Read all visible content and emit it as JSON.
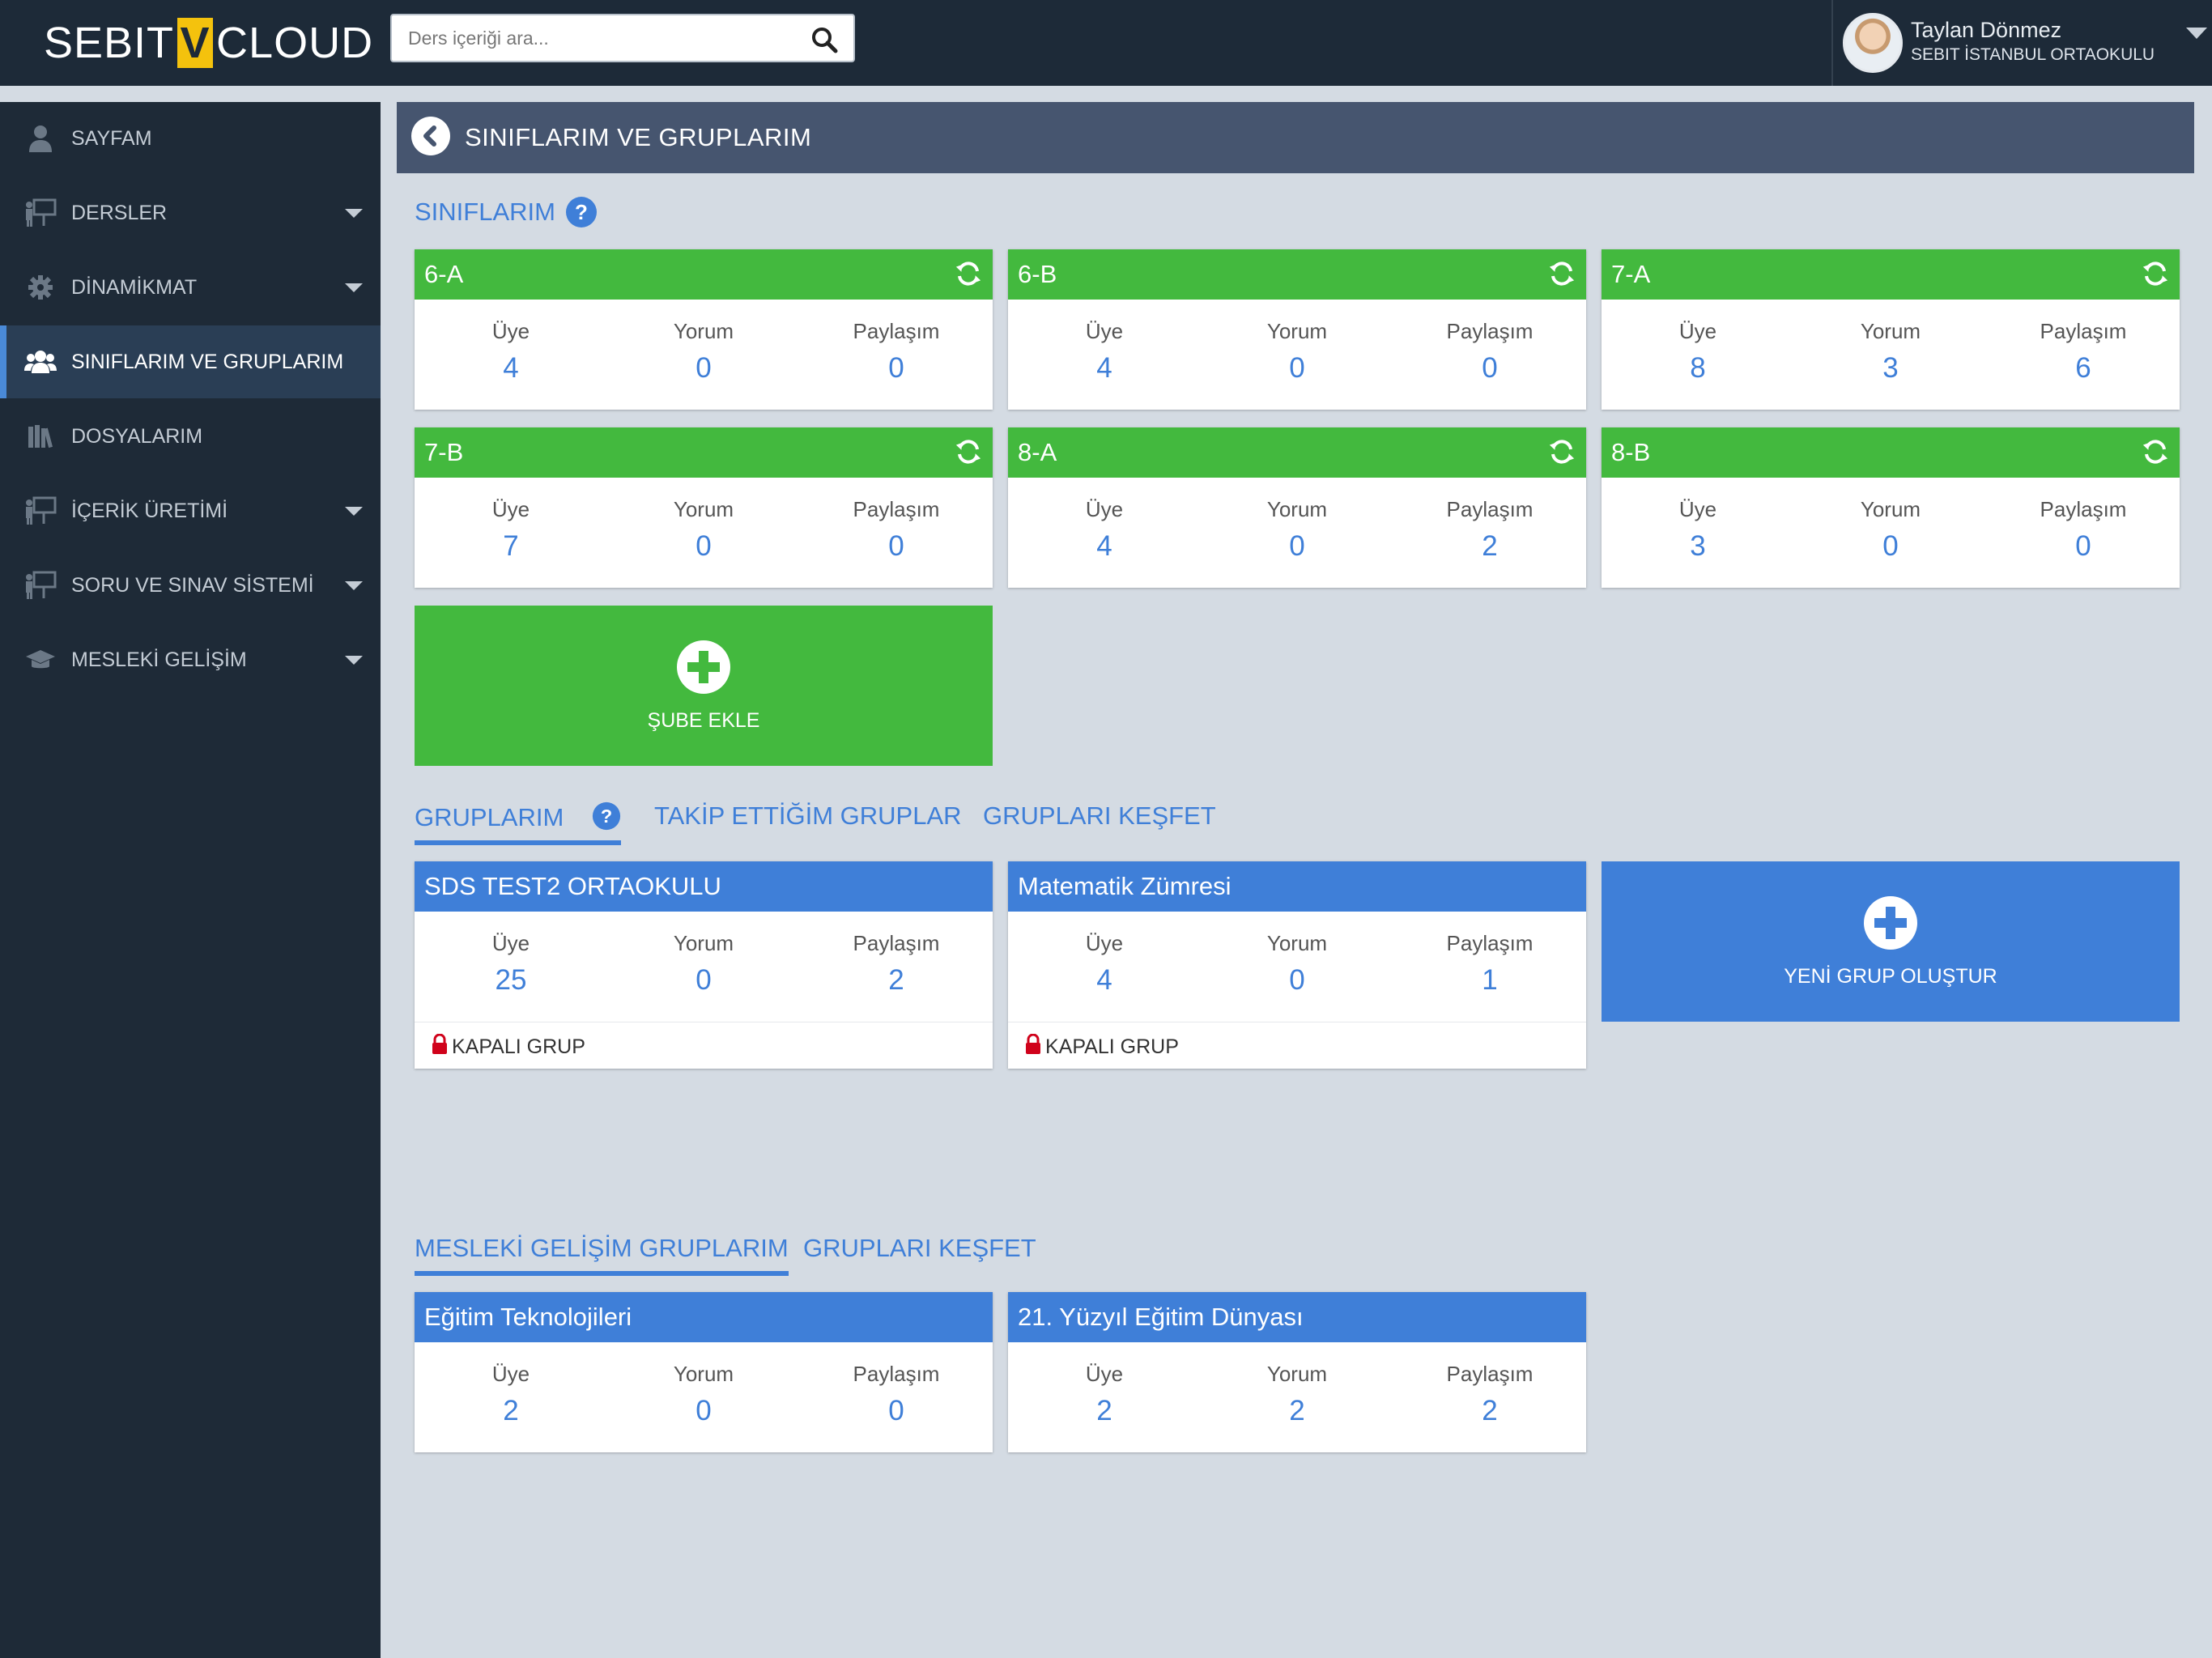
{
  "app": {
    "brand_left": "SEBIT",
    "brand_v": "V",
    "brand_right": "CLOUD"
  },
  "search": {
    "placeholder": "Ders içeriği ara..."
  },
  "user": {
    "name": "Taylan Dönmez",
    "school": "SEBIT İSTANBUL ORTAOKULU"
  },
  "sidebar": {
    "items": [
      {
        "label": "SAYFAM",
        "icon": "person-icon"
      },
      {
        "label": "DERSLER",
        "icon": "presentation-icon"
      },
      {
        "label": "DİNAMİKMAT",
        "icon": "gear-icon"
      },
      {
        "label": "SINIFLARIM VE GRUPLARIM",
        "icon": "users-icon"
      },
      {
        "label": "DOSYALARIM",
        "icon": "library-icon"
      },
      {
        "label": "İÇERİK ÜRETİMİ",
        "icon": "presentation-icon"
      },
      {
        "label": "SORU VE SINAV SİSTEMİ",
        "icon": "presentation-icon"
      },
      {
        "label": "MESLEKİ GELİŞİM",
        "icon": "graduation-cap-icon"
      }
    ]
  },
  "page": {
    "title": "SINIFLARIM VE GRUPLARIM"
  },
  "labels": {
    "uye": "Üye",
    "yorum": "Yorum",
    "paylasim": "Paylaşım"
  },
  "classes": {
    "title": "SINIFLARIM",
    "items": [
      {
        "name": "6-A",
        "uye": "4",
        "yorum": "0",
        "paylasim": "0"
      },
      {
        "name": "6-B",
        "uye": "4",
        "yorum": "0",
        "paylasim": "0"
      },
      {
        "name": "7-A",
        "uye": "8",
        "yorum": "3",
        "paylasim": "6"
      },
      {
        "name": "7-B",
        "uye": "7",
        "yorum": "0",
        "paylasim": "0"
      },
      {
        "name": "8-A",
        "uye": "4",
        "yorum": "0",
        "paylasim": "2"
      },
      {
        "name": "8-B",
        "uye": "3",
        "yorum": "0",
        "paylasim": "0"
      }
    ],
    "add_label": "ŞUBE EKLE"
  },
  "groups": {
    "tabs": [
      "GRUPLARIM",
      "TAKİP ETTİĞİM GRUPLAR",
      "GRUPLARI KEŞFET"
    ],
    "items": [
      {
        "name": "SDS TEST2 ORTAOKULU",
        "uye": "25",
        "yorum": "0",
        "paylasim": "2",
        "status": "KAPALI GRUP"
      },
      {
        "name": "Matematik Zümresi",
        "uye": "4",
        "yorum": "0",
        "paylasim": "1",
        "status": "KAPALI GRUP"
      }
    ],
    "add_label": "YENİ GRUP OLUŞTUR"
  },
  "pro_groups": {
    "tabs": [
      "MESLEKİ GELİŞİM GRUPLARIM",
      "GRUPLARI KEŞFET"
    ],
    "items": [
      {
        "name": "Eğitim Teknolojileri",
        "uye": "2",
        "yorum": "0",
        "paylasim": "0"
      },
      {
        "name": "21. Yüzyıl Eğitim Dünyası",
        "uye": "2",
        "yorum": "2",
        "paylasim": "2"
      }
    ]
  },
  "colors": {
    "topbar": "#1d2a38",
    "sidebar": "#1e2a37",
    "green": "#43b93e",
    "blue": "#3f7fd8",
    "header": "#46556f",
    "background": "#d4dbe3"
  }
}
